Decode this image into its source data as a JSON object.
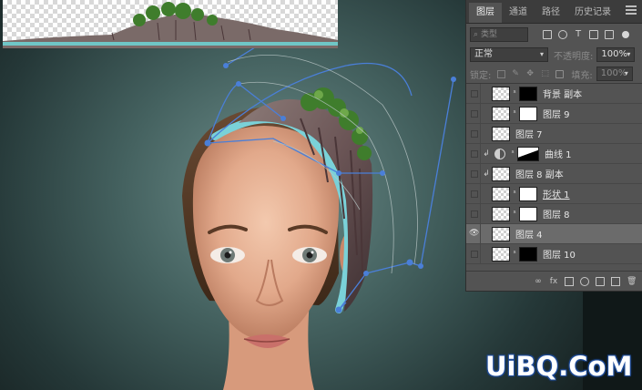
{
  "panel": {
    "tabs": [
      {
        "label": "图层",
        "active": true
      },
      {
        "label": "通道",
        "active": false
      },
      {
        "label": "路径",
        "active": false
      },
      {
        "label": "历史记录",
        "active": false
      }
    ],
    "filter": {
      "placeholder": "类型"
    },
    "blend_mode": "正常",
    "opacity_label": "不透明度:",
    "opacity_value": "100%",
    "lock_label": "锁定:",
    "fill_label": "填充:",
    "fill_value": "100%",
    "layers": [
      {
        "name": "背景 副本",
        "visible": false,
        "selected": false
      },
      {
        "name": "图层 9",
        "visible": false,
        "selected": false
      },
      {
        "name": "图层 7",
        "visible": false,
        "selected": false
      },
      {
        "name": "曲线 1",
        "visible": false,
        "selected": false
      },
      {
        "name": "图层 8 副本",
        "visible": false,
        "selected": false
      },
      {
        "name": "形状 1",
        "visible": false,
        "selected": false
      },
      {
        "name": "图层 8",
        "visible": false,
        "selected": false
      },
      {
        "name": "图层 4",
        "visible": true,
        "selected": true
      },
      {
        "name": "图层 10",
        "visible": false,
        "selected": false
      }
    ],
    "footer_icons": [
      "link-icon",
      "fx-icon",
      "mask-icon",
      "adjustment-icon",
      "folder-icon",
      "new-layer-icon",
      "trash-icon"
    ]
  },
  "watermark": "UiBQ.CoM",
  "colors": {
    "panel_bg": "#535353",
    "path_blue": "#4a7fd8",
    "cyan_rim": "#7ad1d8"
  }
}
